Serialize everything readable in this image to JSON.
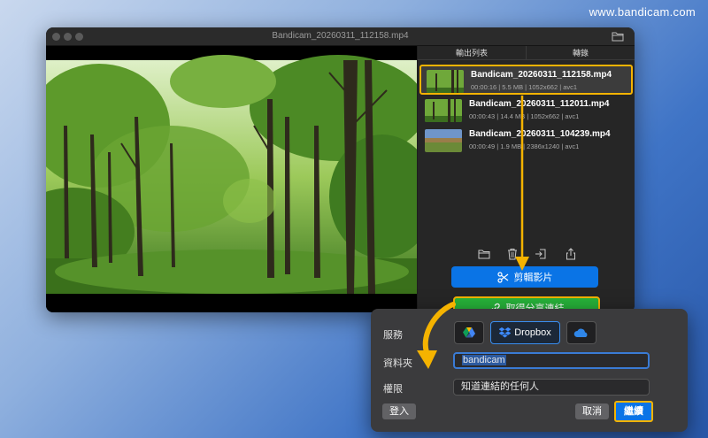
{
  "watermark": "www.bandicam.com",
  "window": {
    "title": "Bandicam_20260311_112158.mp4"
  },
  "panel": {
    "tabs": [
      {
        "label": "輸出列表"
      },
      {
        "label": "轉錄"
      }
    ],
    "files": [
      {
        "name": "Bandicam_20260311_112158.mp4",
        "meta": "00:00:16 | 5.5 MB | 1052x662 | avc1",
        "thumb": "forest"
      },
      {
        "name": "Bandicam_20260311_112011.mp4",
        "meta": "00:00:43 | 14.4 MB | 1052x662 | avc1",
        "thumb": "forest"
      },
      {
        "name": "Bandicam_20260311_104239.mp4",
        "meta": "00:00:49 | 1.9 MB | 2386x1240 | avc1",
        "thumb": "landscape"
      }
    ],
    "toolbar_icons": [
      "folder-icon",
      "trash-icon",
      "import-icon",
      "share-icon"
    ],
    "edit_button": "剪輯影片",
    "share_button": "取得分享連結"
  },
  "dialog": {
    "service_label": "服務",
    "services": [
      {
        "name": "google-drive-icon"
      },
      {
        "name": "dropbox-icon",
        "label": "Dropbox"
      },
      {
        "name": "onedrive-icon"
      }
    ],
    "folder_label": "資料夾",
    "folder_value": "bandicam",
    "permission_label": "權限",
    "permission_value": "知道連結的任何人",
    "login_button": "登入",
    "cancel_button": "取消",
    "continue_button": "繼續"
  },
  "colors": {
    "highlight": "#f5b300",
    "primary_blue": "#0a74e6",
    "share_green": "#27b23a"
  }
}
